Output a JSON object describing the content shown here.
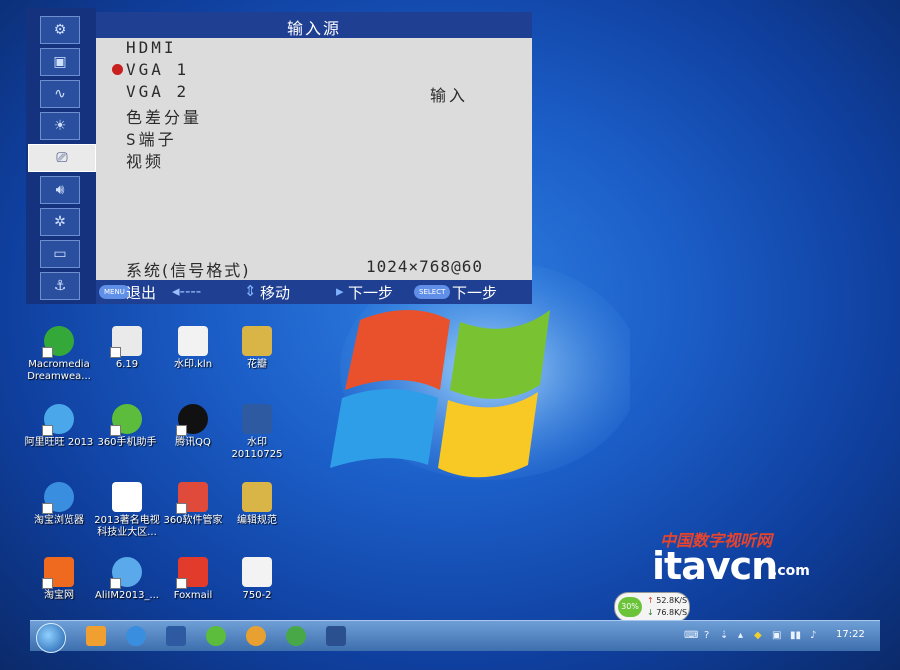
{
  "osd": {
    "title": "输入源",
    "items": [
      "HDMI",
      "VGA 1",
      "VGA 2",
      "色差分量",
      "S端子",
      "视频"
    ],
    "selected_index": 1,
    "input_label": "输入",
    "system_label": "系统(信号格式)",
    "system_value": "1024×768@60",
    "hints": {
      "menu_pill": "MENU",
      "exit": "退出",
      "left_arrows": "◂----",
      "move": "移动",
      "next1": "下一步",
      "select_pill": "SELECT",
      "next2": "下一步"
    },
    "sidebar_icons": [
      "gear-icon",
      "picture-icon",
      "wave-icon",
      "brightness-icon",
      "projector-icon",
      "speaker-icon",
      "settings-icon",
      "monitor-icon",
      "anchor-icon"
    ],
    "selected_sidebar": 4
  },
  "desktop": {
    "icons": [
      {
        "label": "Macromedia Dreamwea...",
        "color": "#35a83a"
      },
      {
        "label": "6.19",
        "color": "#eaeaea"
      },
      {
        "label": "水印.kln",
        "color": "#f2f2f2"
      },
      {
        "label": "花瓣",
        "color": "#d9b548"
      },
      {
        "label": "阿里旺旺 2013",
        "color": "#4aa8ea"
      },
      {
        "label": "360手机助手",
        "color": "#5bbd3b"
      },
      {
        "label": "腾讯QQ",
        "color": "#111111"
      },
      {
        "label": "水印 20110725",
        "color": "#2d5aa0"
      },
      {
        "label": "淘宝浏览器",
        "color": "#3a8ee0"
      },
      {
        "label": "2013著名电视科技业大区...",
        "color": "#ffffff"
      },
      {
        "label": "360软件管家",
        "color": "#e04a3a"
      },
      {
        "label": "编辑规范",
        "color": "#d9b548"
      },
      {
        "label": "淘宝网",
        "color": "#ef6a1f"
      },
      {
        "label": "AliIM2013_...",
        "color": "#5aa9ea"
      },
      {
        "label": "Foxmail",
        "color": "#e23b2b"
      },
      {
        "label": "750-2",
        "color": "#f3f3f3"
      }
    ]
  },
  "watermark": {
    "cn": "中国数字视听网",
    "en": "itavcn",
    "com": ".com"
  },
  "speed": {
    "percent": "30%",
    "up": "52.8K/S",
    "down": "76.8K/S"
  },
  "taskbar": {
    "clock": "17:22"
  }
}
